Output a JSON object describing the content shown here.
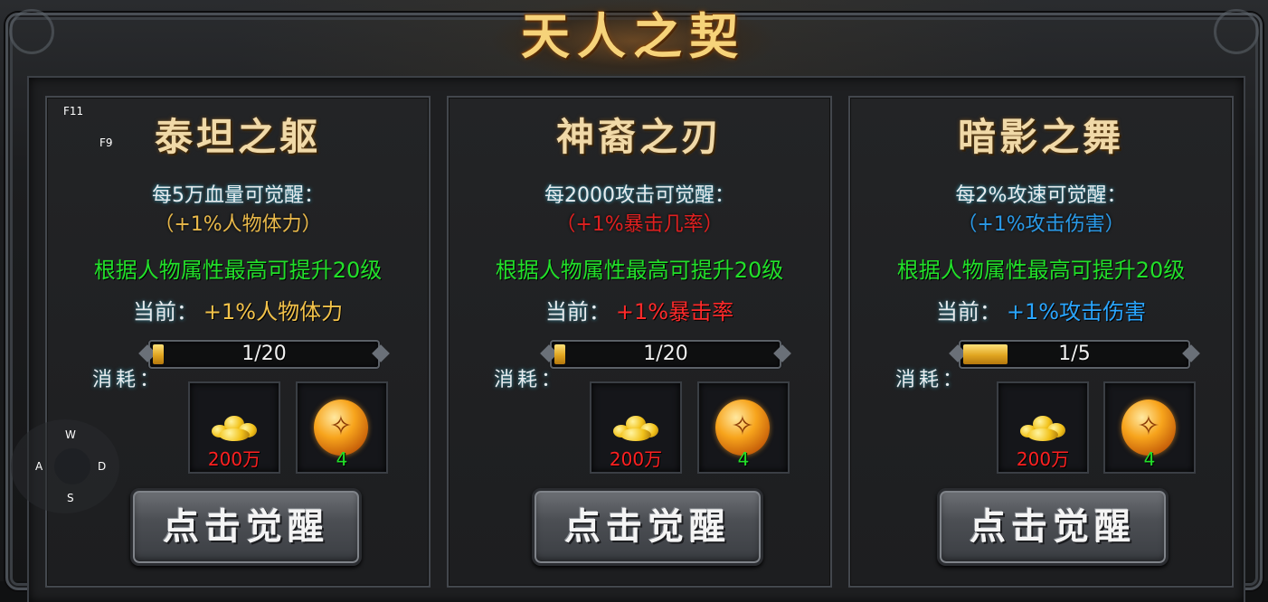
{
  "title": "天人之契",
  "hotkeys": {
    "f11": "F11",
    "f9": "F9"
  },
  "joystick": {
    "up": "W",
    "left": "A",
    "right": "D",
    "down": "S"
  },
  "panels": [
    {
      "title": "泰坦之躯",
      "condition": "每5万血量可觉醒：",
      "bonus": "（+1%人物体力）",
      "bonus_color": "#e8b84a",
      "max_text": "根据人物属性最高可提升20级",
      "current_label": "当前：",
      "current_value": "+1%人物体力",
      "current_color": "#f2c24a",
      "progress_text": "1/20",
      "progress": 0.05,
      "cost_label": "消耗：",
      "cost_gold": "200万",
      "cost_item": "4",
      "button_label": "点击觉醒"
    },
    {
      "title": "神裔之刃",
      "condition": "每2000攻击可觉醒：",
      "bonus": "（+1%暴击几率）",
      "bonus_color": "#e02020",
      "max_text": "根据人物属性最高可提升20级",
      "current_label": "当前：",
      "current_value": "+1%暴击率",
      "current_color": "#ff2a2a",
      "progress_text": "1/20",
      "progress": 0.05,
      "cost_label": "消耗：",
      "cost_gold": "200万",
      "cost_item": "4",
      "button_label": "点击觉醒"
    },
    {
      "title": "暗影之舞",
      "condition": "每2%攻速可觉醒：",
      "bonus": "（+1%攻击伤害）",
      "bonus_color": "#2a9ae8",
      "max_text": "根据人物属性最高可提升20级",
      "current_label": "当前：",
      "current_value": "+1%攻击伤害",
      "current_color": "#2aa6ff",
      "progress_text": "1/5",
      "progress": 0.2,
      "cost_label": "消耗：",
      "cost_gold": "200万",
      "cost_item": "4",
      "button_label": "点击觉醒"
    }
  ],
  "colors": {
    "gold_qty": "#ff2020",
    "item_qty": "#22e02a",
    "max_text": "#22e02a"
  }
}
